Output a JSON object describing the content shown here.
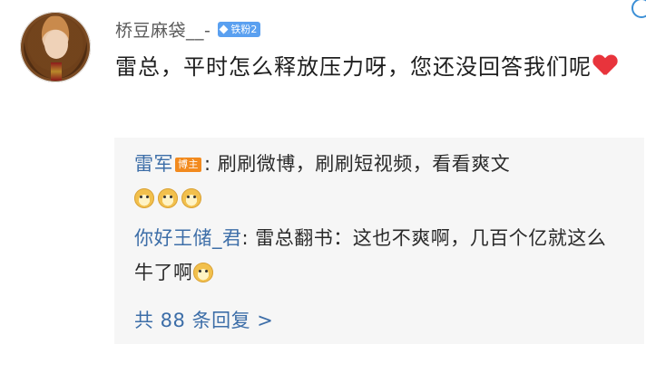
{
  "comment": {
    "username": "桥豆麻袋__-",
    "fan_badge": "铁粉2",
    "text": "雷总，平时怎么释放压力呀，您还没回答我们呢"
  },
  "replies": [
    {
      "author": "雷军",
      "badge": "博主",
      "text": ": 刷刷微博，刷刷短视频，看看爽文",
      "emoji": [
        "doge-icon",
        "doge-icon",
        "doge-icon"
      ]
    },
    {
      "author": "你好王储_君",
      "text": ": 雷总翻书：这也不爽啊，几百个亿就这么牛了啊",
      "emoji": [
        "doge-icon"
      ]
    }
  ],
  "more_replies": "共 88 条回复 >",
  "colors": {
    "link_blue": "#3d6ea8",
    "badge_orange": "#f28a1e",
    "fan_badge_blue": "#5aa0f0",
    "heart_red": "#e8343c",
    "reply_bg": "#f6f6f6"
  }
}
